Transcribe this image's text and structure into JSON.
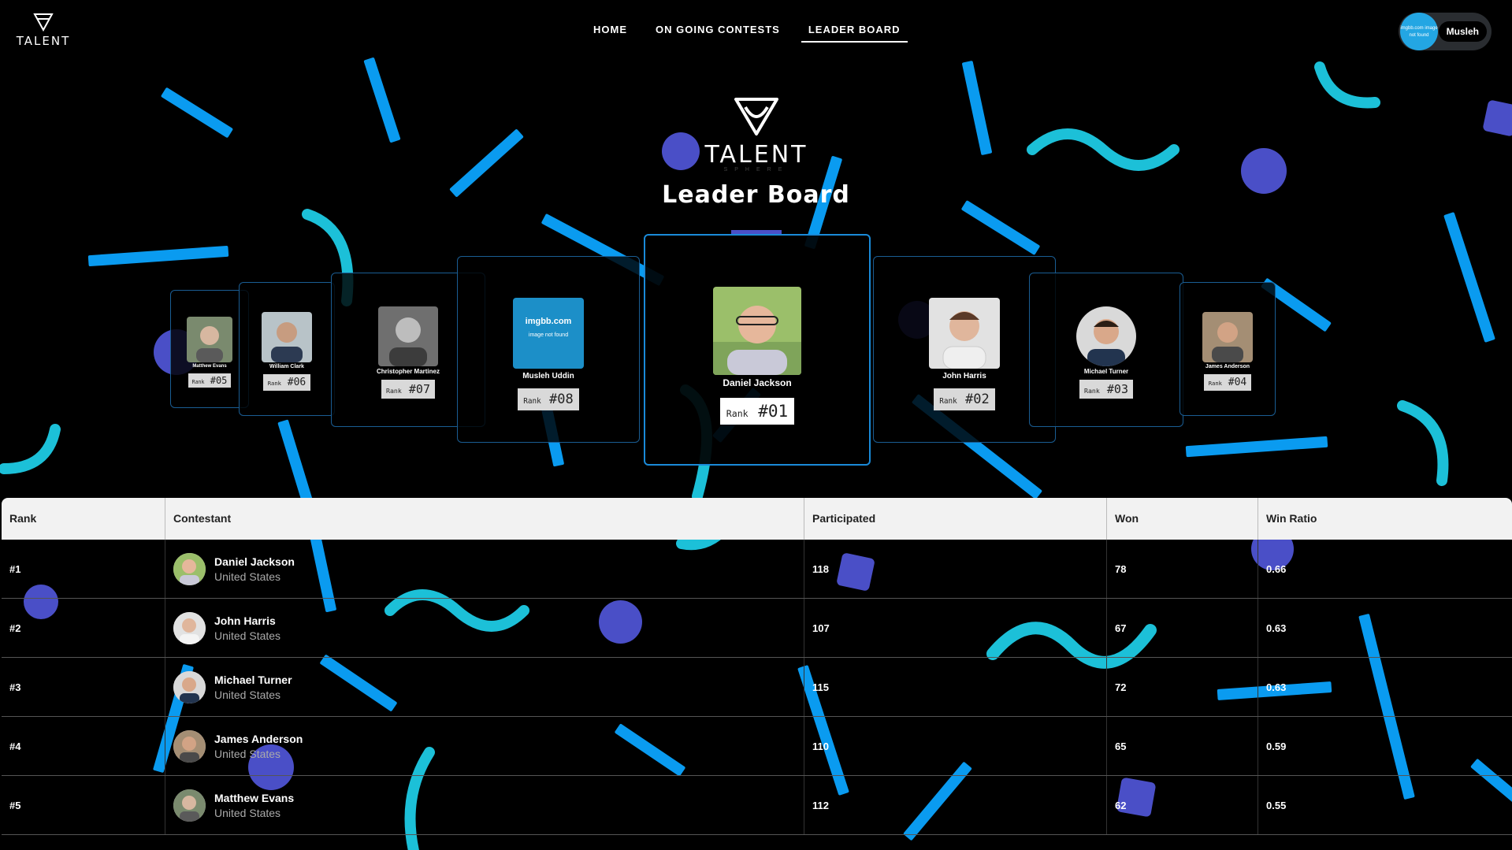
{
  "brand": {
    "logo_text": "TALENT"
  },
  "nav": {
    "items": [
      {
        "label": "HOME",
        "active": false
      },
      {
        "label": "ON GOING CONTESTS",
        "active": false
      },
      {
        "label": "LEADER BOARD",
        "active": true
      }
    ]
  },
  "user": {
    "avatar_text": "imgbb.com image not found",
    "name": "Musleh"
  },
  "hero": {
    "logo_word": "TALENT",
    "logo_sub": "SPHERE",
    "title": "Leader Board"
  },
  "carousel": [
    {
      "name": "Matthew Evans",
      "rank_label": "Rank",
      "rank": "#05"
    },
    {
      "name": "William Clark",
      "rank_label": "Rank",
      "rank": "#06"
    },
    {
      "name": "Christopher Martinez",
      "rank_label": "Rank",
      "rank": "#07"
    },
    {
      "name": "Musleh Uddin",
      "rank_label": "Rank",
      "rank": "#08",
      "placeholder_title": "imgbb.com",
      "placeholder_sub": "image not found"
    },
    {
      "name": "Daniel Jackson",
      "rank_label": "Rank",
      "rank": "#01"
    },
    {
      "name": "John Harris",
      "rank_label": "Rank",
      "rank": "#02"
    },
    {
      "name": "Michael Turner",
      "rank_label": "Rank",
      "rank": "#03"
    },
    {
      "name": "James Anderson",
      "rank_label": "Rank",
      "rank": "#04"
    }
  ],
  "table": {
    "headers": [
      "Rank",
      "Contestant",
      "Participated",
      "Won",
      "Win Ratio"
    ],
    "rows": [
      {
        "rank": "#1",
        "name": "Daniel Jackson",
        "country": "United States",
        "participated": "118",
        "won": "78",
        "ratio": "0.66"
      },
      {
        "rank": "#2",
        "name": "John Harris",
        "country": "United States",
        "participated": "107",
        "won": "67",
        "ratio": "0.63"
      },
      {
        "rank": "#3",
        "name": "Michael Turner",
        "country": "United States",
        "participated": "115",
        "won": "72",
        "ratio": "0.63"
      },
      {
        "rank": "#4",
        "name": "James Anderson",
        "country": "United States",
        "participated": "110",
        "won": "65",
        "ratio": "0.59"
      },
      {
        "rank": "#5",
        "name": "Matthew Evans",
        "country": "United States",
        "participated": "112",
        "won": "62",
        "ratio": "0.55"
      }
    ]
  },
  "colors": {
    "accent_blue": "#0a9bf0",
    "accent_purple": "#4a4fc7",
    "accent_cyan": "#1cc0d8",
    "card_border": "#1a5d93"
  }
}
